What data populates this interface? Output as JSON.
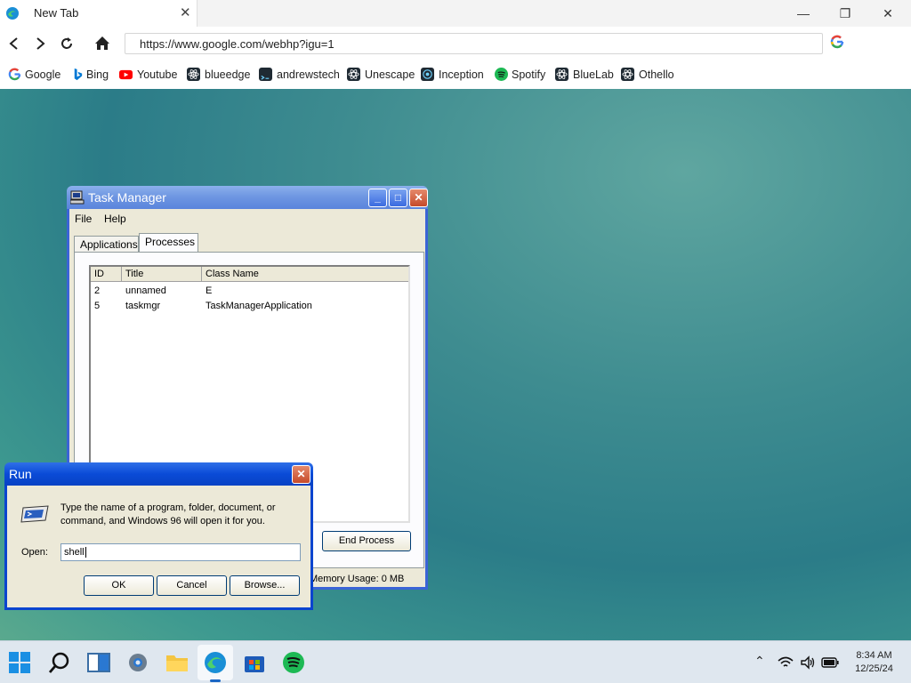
{
  "browser": {
    "tab_title": "New Tab",
    "tab_close": "✕",
    "url": "https://www.google.com/webhp?igu=1",
    "window_controls": {
      "minimize": "—",
      "restore": "❐",
      "close": "✕"
    },
    "bookmarks": [
      {
        "label": "Google",
        "icon": "google-icon",
        "color": "#4285f4"
      },
      {
        "label": "Bing",
        "icon": "bing-icon",
        "color": "#0078d4"
      },
      {
        "label": "Youtube",
        "icon": "youtube-icon",
        "color": "#ff0000"
      },
      {
        "label": "blueedge",
        "icon": "react-icon",
        "color": "#1f2a33"
      },
      {
        "label": "andrewstech",
        "icon": "terminal-icon",
        "color": "#1f2a33"
      },
      {
        "label": "Unescape",
        "icon": "react-icon",
        "color": "#1f2a33"
      },
      {
        "label": "Inception",
        "icon": "react-icon",
        "color": "#1f2a33"
      },
      {
        "label": "Spotify",
        "icon": "spotify-icon",
        "color": "#1db954"
      },
      {
        "label": "BlueLab",
        "icon": "react-icon",
        "color": "#1f2a33"
      },
      {
        "label": "Othello",
        "icon": "react-icon",
        "color": "#1f2a33"
      }
    ]
  },
  "task_manager": {
    "title": "Task Manager",
    "menu": [
      "File",
      "Help"
    ],
    "tabs": [
      "Applications",
      "Processes"
    ],
    "active_tab": "Processes",
    "columns": [
      "ID",
      "Title",
      "Class Name"
    ],
    "rows": [
      {
        "id": "2",
        "title": "unnamed",
        "class_name": "E"
      },
      {
        "id": "5",
        "title": "taskmgr",
        "class_name": "TaskManagerApplication"
      }
    ],
    "end_process_label": "End Process",
    "status_text": "Memory Usage: 0 MB"
  },
  "run_dialog": {
    "title": "Run",
    "description": "Type the name of a program, folder, document, or command, and Windows 96 will open it for you.",
    "open_label": "Open:",
    "open_value": "shell",
    "ok_label": "OK",
    "cancel_label": "Cancel",
    "browse_label": "Browse..."
  },
  "taskbar": {
    "apps": [
      "start-icon",
      "search-icon",
      "task-view-icon",
      "settings-icon",
      "file-explorer-icon",
      "edge-icon",
      "store-icon",
      "spotify-icon"
    ],
    "active_app": "edge-icon",
    "time": "8:34 AM",
    "date": "12/25/24"
  },
  "colors": {
    "xp_title": "#5a84dc",
    "xp_border": "#3b64d6",
    "desktop": "#3e8c90",
    "taskbar_active": "#1a66c4"
  }
}
